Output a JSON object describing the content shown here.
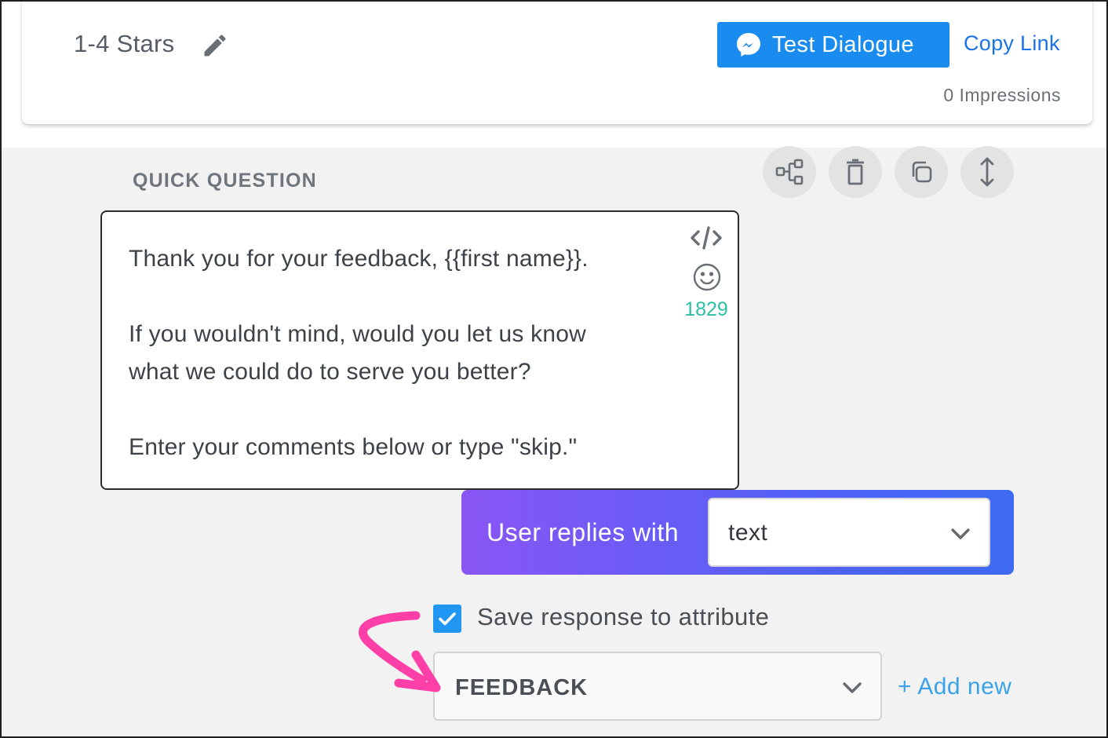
{
  "header": {
    "title": "1-4 Stars",
    "test_button_label": "Test Dialogue",
    "copy_link_label": "Copy Link",
    "impressions": "0 Impressions"
  },
  "section": {
    "label": "QUICK QUESTION"
  },
  "tools": [
    {
      "icon": "flow-tree-icon"
    },
    {
      "icon": "trash-icon"
    },
    {
      "icon": "copy-icon"
    },
    {
      "icon": "vertical-resize-icon"
    }
  ],
  "message": {
    "text": "Thank you for your feedback, {{first name}}.\n\nIf you wouldn't mind, would you let us know\nwhat we could do to serve you better?\n\nEnter your comments below or type \"skip.\"",
    "char_count": "1829"
  },
  "reply": {
    "label": "User replies with",
    "selected": "text"
  },
  "save_response": {
    "checked": true,
    "label": "Save response to attribute",
    "attribute_selected": "FEEDBACK",
    "add_new_label": "+ Add new"
  },
  "colors": {
    "primary_blue": "#1a8cf0",
    "link_blue": "#1a73e8",
    "count_teal": "#2bbfa4",
    "gradient_start": "#8a55f5",
    "gradient_end": "#3e6af4",
    "annotation_pink": "#ff3fa8",
    "checkbox_blue": "#2196f3"
  }
}
